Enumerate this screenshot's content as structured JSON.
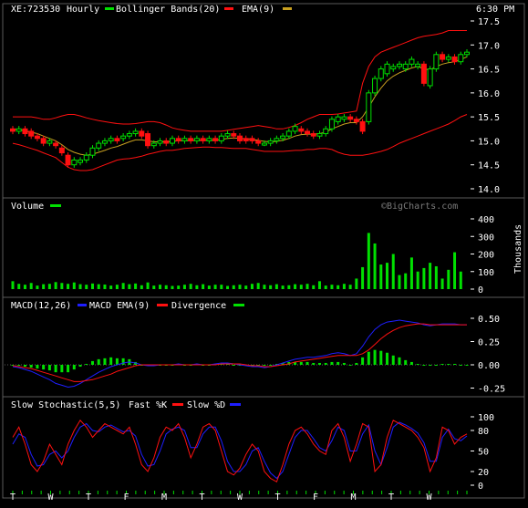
{
  "header": {
    "symbol": "XE:723530",
    "interval": "Hourly",
    "bb_label": "Bollinger Bands(20)",
    "ema_label": "EMA(9)",
    "time": "6:30 PM"
  },
  "colors": {
    "background": "#000000",
    "panel_border": "#5a5a5a",
    "text": "#ffffff",
    "up": "#00e000",
    "down": "#ff1010",
    "bollinger": "#ff1010",
    "ema": "#c8a020",
    "volume": "#00e000",
    "macd": "#1e1eff",
    "macd_ema": "#ff1010",
    "divergence": "#00e000",
    "slow_k": "#ff1010",
    "slow_d": "#1e1eff",
    "watermark": "#7a7a7a"
  },
  "watermark": "©BigCharts.com",
  "panels": {
    "price": {
      "y_ticks": [
        "17.5",
        "17.0",
        "16.5",
        "16.0",
        "15.5",
        "15.0",
        "14.5",
        "14.0"
      ],
      "y_values": [
        17.5,
        17.0,
        16.5,
        16.0,
        15.5,
        15.0,
        14.5,
        14.0
      ]
    },
    "volume": {
      "label": "Volume",
      "y_ticks": [
        "400",
        "300",
        "200",
        "100",
        "0"
      ],
      "y_values": [
        400,
        300,
        200,
        100,
        0
      ],
      "unit": "Thousands"
    },
    "macd": {
      "label": "MACD(12,26)",
      "ema_label": "MACD EMA(9)",
      "div_label": "Divergence",
      "y_ticks": [
        "0.50",
        "0.25",
        "0.00",
        "-0.25"
      ],
      "y_values": [
        0.5,
        0.25,
        0.0,
        -0.25
      ]
    },
    "stoch": {
      "label": "Slow Stochastic(5,5)",
      "k_label": "Fast %K",
      "slow_label": "Slow %D",
      "y_ticks": [
        "100",
        "80",
        "50",
        "20",
        "0"
      ],
      "y_values": [
        100,
        80,
        50,
        20,
        0
      ]
    }
  },
  "x_axis": {
    "labels": [
      "T",
      "W",
      "T",
      "F",
      "M",
      "T",
      "W",
      "T",
      "F",
      "M",
      "T",
      "W"
    ],
    "minor_per_label": 4
  },
  "chart_data": {
    "type": "line",
    "price_candles": [
      {
        "o": 15.25,
        "c": 15.2
      },
      {
        "o": 15.2,
        "c": 15.25
      },
      {
        "o": 15.25,
        "c": 15.15
      },
      {
        "o": 15.2,
        "c": 15.1
      },
      {
        "o": 15.1,
        "c": 15.05
      },
      {
        "o": 15.05,
        "c": 14.95
      },
      {
        "o": 14.95,
        "c": 15.0
      },
      {
        "o": 14.95,
        "c": 14.9
      },
      {
        "o": 14.85,
        "c": 14.75
      },
      {
        "o": 14.7,
        "c": 14.5
      },
      {
        "o": 14.5,
        "c": 14.6
      },
      {
        "o": 14.55,
        "c": 14.6
      },
      {
        "o": 14.6,
        "c": 14.7
      },
      {
        "o": 14.7,
        "c": 14.85
      },
      {
        "o": 14.85,
        "c": 14.95
      },
      {
        "o": 14.95,
        "c": 15.0
      },
      {
        "o": 15.0,
        "c": 15.05
      },
      {
        "o": 15.05,
        "c": 15.0
      },
      {
        "o": 15.05,
        "c": 15.1
      },
      {
        "o": 15.1,
        "c": 15.15
      },
      {
        "o": 15.15,
        "c": 15.2
      },
      {
        "o": 15.2,
        "c": 15.1
      },
      {
        "o": 15.15,
        "c": 14.9
      },
      {
        "o": 14.9,
        "c": 14.95
      },
      {
        "o": 14.95,
        "c": 15.0
      },
      {
        "o": 15.0,
        "c": 14.95
      },
      {
        "o": 14.95,
        "c": 15.05
      },
      {
        "o": 15.05,
        "c": 15.0
      },
      {
        "o": 15.0,
        "c": 15.05
      },
      {
        "o": 15.05,
        "c": 15.0
      },
      {
        "o": 15.0,
        "c": 15.05
      },
      {
        "o": 15.05,
        "c": 15.0
      },
      {
        "o": 15.0,
        "c": 15.05
      },
      {
        "o": 15.05,
        "c": 15.0
      },
      {
        "o": 15.0,
        "c": 15.1
      },
      {
        "o": 15.1,
        "c": 15.15
      },
      {
        "o": 15.15,
        "c": 15.1
      },
      {
        "o": 15.1,
        "c": 15.0
      },
      {
        "o": 15.05,
        "c": 15.0
      },
      {
        "o": 15.05,
        "c": 15.0
      },
      {
        "o": 15.0,
        "c": 14.95
      },
      {
        "o": 14.95,
        "c": 14.95
      },
      {
        "o": 14.95,
        "c": 15.0
      },
      {
        "o": 15.0,
        "c": 15.05
      },
      {
        "o": 15.05,
        "c": 15.1
      },
      {
        "o": 15.1,
        "c": 15.2
      },
      {
        "o": 15.2,
        "c": 15.3
      },
      {
        "o": 15.25,
        "c": 15.2
      },
      {
        "o": 15.2,
        "c": 15.15
      },
      {
        "o": 15.15,
        "c": 15.1
      },
      {
        "o": 15.1,
        "c": 15.15
      },
      {
        "o": 15.15,
        "c": 15.25
      },
      {
        "o": 15.25,
        "c": 15.45
      },
      {
        "o": 15.4,
        "c": 15.5
      },
      {
        "o": 15.45,
        "c": 15.5
      },
      {
        "o": 15.5,
        "c": 15.45
      },
      {
        "o": 15.45,
        "c": 15.4
      },
      {
        "o": 15.4,
        "c": 15.2
      },
      {
        "o": 15.4,
        "c": 16.0
      },
      {
        "o": 16.0,
        "c": 16.3
      },
      {
        "o": 16.3,
        "c": 16.5
      },
      {
        "o": 16.4,
        "c": 16.6
      },
      {
        "o": 16.5,
        "c": 16.55
      },
      {
        "o": 16.55,
        "c": 16.6
      },
      {
        "o": 16.5,
        "c": 16.6
      },
      {
        "o": 16.6,
        "c": 16.7
      },
      {
        "o": 16.55,
        "c": 16.6
      },
      {
        "o": 16.6,
        "c": 16.2
      },
      {
        "o": 16.15,
        "c": 16.5
      },
      {
        "o": 16.5,
        "c": 16.8
      },
      {
        "o": 16.8,
        "c": 16.7
      },
      {
        "o": 16.7,
        "c": 16.75
      },
      {
        "o": 16.75,
        "c": 16.65
      },
      {
        "o": 16.65,
        "c": 16.8
      },
      {
        "o": 16.8,
        "c": 16.85
      }
    ],
    "volume": [
      45,
      30,
      25,
      35,
      20,
      28,
      30,
      40,
      35,
      30,
      38,
      28,
      25,
      32,
      28,
      26,
      20,
      25,
      35,
      28,
      32,
      22,
      38,
      20,
      25,
      22,
      18,
      20,
      25,
      30,
      22,
      28,
      20,
      25,
      25,
      18,
      22,
      25,
      20,
      30,
      35,
      25,
      22,
      28,
      20,
      22,
      28,
      25,
      30,
      22,
      45,
      20,
      25,
      22,
      30,
      25,
      60,
      125,
      320,
      260,
      140,
      150,
      200,
      80,
      90,
      180,
      100,
      120,
      150,
      130,
      60,
      110,
      210,
      100
    ],
    "macd": [
      -0.02,
      -0.03,
      -0.05,
      -0.07,
      -0.1,
      -0.13,
      -0.16,
      -0.2,
      -0.22,
      -0.24,
      -0.23,
      -0.2,
      -0.16,
      -0.12,
      -0.08,
      -0.05,
      -0.02,
      0.0,
      0.02,
      0.03,
      0.02,
      0.0,
      -0.01,
      -0.01,
      0.0,
      0.0,
      0.0,
      0.01,
      0.0,
      0.0,
      0.01,
      0.0,
      0.0,
      0.01,
      0.02,
      0.02,
      0.01,
      0.0,
      -0.01,
      -0.02,
      -0.02,
      -0.03,
      -0.02,
      0.0,
      0.02,
      0.04,
      0.06,
      0.07,
      0.08,
      0.08,
      0.09,
      0.1,
      0.12,
      0.13,
      0.12,
      0.1,
      0.12,
      0.2,
      0.3,
      0.38,
      0.43,
      0.46,
      0.47,
      0.48,
      0.47,
      0.46,
      0.45,
      0.43,
      0.42,
      0.43,
      0.44,
      0.44,
      0.44,
      0.43,
      0.43
    ],
    "macd_ema": [
      -0.01,
      -0.02,
      -0.03,
      -0.04,
      -0.06,
      -0.08,
      -0.1,
      -0.12,
      -0.14,
      -0.16,
      -0.18,
      -0.18,
      -0.17,
      -0.16,
      -0.14,
      -0.12,
      -0.1,
      -0.07,
      -0.05,
      -0.03,
      -0.01,
      0.0,
      0.0,
      0.0,
      0.0,
      0.0,
      0.0,
      0.0,
      0.0,
      0.0,
      0.0,
      0.0,
      0.0,
      0.0,
      0.01,
      0.01,
      0.01,
      0.01,
      0.0,
      -0.01,
      -0.01,
      -0.02,
      -0.02,
      -0.01,
      0.0,
      0.01,
      0.03,
      0.04,
      0.05,
      0.06,
      0.07,
      0.08,
      0.09,
      0.1,
      0.1,
      0.1,
      0.1,
      0.12,
      0.16,
      0.22,
      0.28,
      0.33,
      0.37,
      0.4,
      0.42,
      0.43,
      0.44,
      0.44,
      0.43,
      0.43,
      0.43,
      0.43,
      0.43,
      0.43,
      0.43
    ],
    "divergence": [
      -0.01,
      -0.01,
      -0.02,
      -0.03,
      -0.04,
      -0.05,
      -0.06,
      -0.08,
      -0.08,
      -0.08,
      -0.05,
      -0.02,
      0.01,
      0.04,
      0.06,
      0.07,
      0.08,
      0.07,
      0.07,
      0.06,
      0.03,
      0.0,
      -0.01,
      -0.01,
      0.0,
      0.0,
      0.0,
      0.01,
      0.0,
      0.0,
      0.01,
      0.0,
      0.0,
      0.01,
      0.01,
      0.01,
      0.0,
      -0.01,
      -0.01,
      -0.01,
      -0.01,
      -0.01,
      0.0,
      0.01,
      0.02,
      0.03,
      0.03,
      0.03,
      0.03,
      0.02,
      0.02,
      0.02,
      0.03,
      0.03,
      0.02,
      0.0,
      0.02,
      0.08,
      0.14,
      0.16,
      0.15,
      0.13,
      0.1,
      0.08,
      0.05,
      0.03,
      0.01,
      -0.01,
      -0.01,
      0.0,
      0.01,
      0.01,
      0.01,
      0.0,
      0.0
    ],
    "stoch_k": [
      70,
      85,
      60,
      30,
      20,
      35,
      60,
      45,
      30,
      60,
      80,
      95,
      85,
      70,
      80,
      90,
      85,
      80,
      75,
      85,
      60,
      30,
      20,
      40,
      70,
      85,
      80,
      90,
      70,
      40,
      60,
      85,
      90,
      80,
      50,
      20,
      15,
      25,
      45,
      60,
      50,
      20,
      10,
      5,
      30,
      60,
      80,
      85,
      75,
      60,
      50,
      45,
      80,
      90,
      70,
      35,
      60,
      90,
      85,
      20,
      30,
      70,
      95,
      90,
      85,
      80,
      70,
      55,
      20,
      40,
      85,
      80,
      60,
      70,
      75
    ],
    "stoch_d": [
      60,
      75,
      70,
      45,
      28,
      30,
      45,
      50,
      40,
      50,
      70,
      85,
      90,
      80,
      78,
      85,
      88,
      83,
      78,
      80,
      72,
      45,
      28,
      30,
      50,
      75,
      82,
      85,
      80,
      55,
      55,
      75,
      85,
      85,
      65,
      35,
      20,
      20,
      30,
      50,
      55,
      35,
      18,
      10,
      20,
      45,
      70,
      80,
      80,
      68,
      55,
      50,
      65,
      85,
      80,
      50,
      50,
      75,
      88,
      50,
      30,
      55,
      85,
      92,
      88,
      83,
      76,
      62,
      35,
      35,
      70,
      82,
      68,
      65,
      72
    ],
    "bb_upper": [
      15.5,
      15.5,
      15.5,
      15.5,
      15.48,
      15.45,
      15.45,
      15.48,
      15.52,
      15.55,
      15.55,
      15.52,
      15.48,
      15.45,
      15.42,
      15.4,
      15.38,
      15.36,
      15.35,
      15.35,
      15.36,
      15.38,
      15.4,
      15.4,
      15.38,
      15.33,
      15.27,
      15.24,
      15.22,
      15.2,
      15.2,
      15.2,
      15.2,
      15.2,
      15.2,
      15.22,
      15.24,
      15.26,
      15.28,
      15.3,
      15.32,
      15.3,
      15.28,
      15.25,
      15.25,
      15.28,
      15.32,
      15.38,
      15.45,
      15.5,
      15.55,
      15.55,
      15.55,
      15.56,
      15.58,
      15.6,
      15.62,
      16.2,
      16.55,
      16.75,
      16.85,
      16.9,
      16.95,
      17.0,
      17.05,
      17.1,
      17.15,
      17.18,
      17.2,
      17.22,
      17.25,
      17.3,
      17.3,
      17.3,
      17.3
    ],
    "bb_lower": [
      14.95,
      14.92,
      14.88,
      14.84,
      14.8,
      14.75,
      14.7,
      14.65,
      14.55,
      14.45,
      14.4,
      14.38,
      14.38,
      14.4,
      14.45,
      14.5,
      14.55,
      14.6,
      14.62,
      14.63,
      14.65,
      14.68,
      14.72,
      14.75,
      14.78,
      14.8,
      14.8,
      14.82,
      14.84,
      14.85,
      14.86,
      14.87,
      14.87,
      14.86,
      14.86,
      14.85,
      14.84,
      14.84,
      14.84,
      14.82,
      14.8,
      14.78,
      14.78,
      14.78,
      14.78,
      14.79,
      14.8,
      14.8,
      14.82,
      14.82,
      14.84,
      14.84,
      14.82,
      14.76,
      14.72,
      14.7,
      14.7,
      14.7,
      14.72,
      14.75,
      14.78,
      14.82,
      14.88,
      14.95,
      15.0,
      15.05,
      15.1,
      15.15,
      15.2,
      15.25,
      15.3,
      15.35,
      15.42,
      15.5,
      15.55
    ],
    "ema": [
      15.25,
      15.23,
      15.21,
      15.18,
      15.15,
      15.1,
      15.05,
      15.0,
      14.92,
      14.82,
      14.76,
      14.72,
      14.7,
      14.72,
      14.76,
      14.8,
      14.85,
      14.88,
      14.93,
      14.98,
      15.02,
      15.02,
      15.0,
      14.98,
      14.98,
      14.98,
      14.99,
      15.0,
      15.0,
      15.0,
      15.01,
      15.01,
      15.01,
      15.01,
      15.03,
      15.05,
      15.06,
      15.05,
      15.04,
      15.03,
      15.01,
      14.99,
      14.98,
      14.99,
      15.01,
      15.05,
      15.1,
      15.13,
      15.14,
      15.14,
      15.15,
      15.18,
      15.25,
      15.3,
      15.35,
      15.38,
      15.38,
      15.5,
      15.7,
      15.92,
      16.1,
      16.25,
      16.35,
      16.42,
      16.47,
      16.52,
      16.55,
      16.5,
      16.48,
      16.55,
      16.6,
      16.63,
      16.65,
      16.7,
      16.75
    ]
  }
}
